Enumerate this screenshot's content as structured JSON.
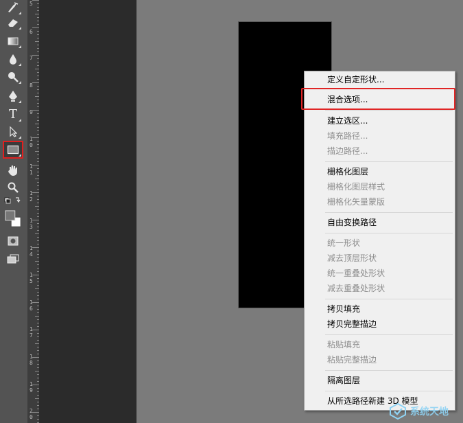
{
  "ruler": {
    "labels": [
      {
        "text": "5"
      },
      {
        "text": "6"
      },
      {
        "text": "7"
      },
      {
        "text": "8"
      },
      {
        "text": "9"
      },
      {
        "text": "1\n0"
      },
      {
        "text": "1\n1"
      },
      {
        "text": "1\n2"
      },
      {
        "text": "1\n3"
      },
      {
        "text": "1\n4"
      },
      {
        "text": "1\n5"
      },
      {
        "text": "1\n6"
      },
      {
        "text": "1\n7"
      },
      {
        "text": "1\n8"
      },
      {
        "text": "1\n9"
      },
      {
        "text": "2\n0"
      }
    ]
  },
  "toolbar": {
    "tools": [
      {
        "name": "spot-healing-brush-icon",
        "glyph": "✎"
      },
      {
        "name": "eraser-icon",
        "glyph": "▱"
      },
      {
        "name": "gradient-icon",
        "glyph": "▭"
      },
      {
        "name": "blur-icon",
        "glyph": "💧"
      },
      {
        "name": "dodge-icon",
        "glyph": "🔍"
      },
      {
        "name": "pen-icon",
        "glyph": "✒"
      },
      {
        "name": "type-icon",
        "glyph": "T"
      },
      {
        "name": "path-selection-icon",
        "glyph": "↖"
      },
      {
        "name": "rectangle-tool-icon",
        "glyph": "▭"
      },
      {
        "name": "hand-icon",
        "glyph": "✋"
      },
      {
        "name": "zoom-icon",
        "glyph": "🔍"
      }
    ]
  },
  "context_menu": {
    "items": [
      {
        "label": "定义自定形状...",
        "enabled": true
      },
      {
        "label": "混合选项...",
        "enabled": true
      },
      {
        "label": "建立选区...",
        "enabled": true
      },
      {
        "label": "填充路径...",
        "enabled": false
      },
      {
        "label": "描边路径...",
        "enabled": false
      },
      {
        "label": "栅格化图层",
        "enabled": true
      },
      {
        "label": "栅格化图层样式",
        "enabled": false
      },
      {
        "label": "栅格化矢量蒙版",
        "enabled": false
      },
      {
        "label": "自由变换路径",
        "enabled": true
      },
      {
        "label": "统一形状",
        "enabled": false
      },
      {
        "label": "减去顶层形状",
        "enabled": false
      },
      {
        "label": "统一重叠处形状",
        "enabled": false
      },
      {
        "label": "减去重叠处形状",
        "enabled": false
      },
      {
        "label": "拷贝填充",
        "enabled": true
      },
      {
        "label": "拷贝完整描边",
        "enabled": true
      },
      {
        "label": "粘贴填充",
        "enabled": false
      },
      {
        "label": "粘贴完整描边",
        "enabled": false
      },
      {
        "label": "隔离图层",
        "enabled": true
      },
      {
        "label": "从所选路径新建 3D 模型",
        "enabled": true
      }
    ]
  },
  "watermark": {
    "text": "系统天地"
  },
  "colors": {
    "highlight": "#e02525",
    "menu_bg": "#f0f0f0",
    "toolbar_bg": "#535353"
  }
}
